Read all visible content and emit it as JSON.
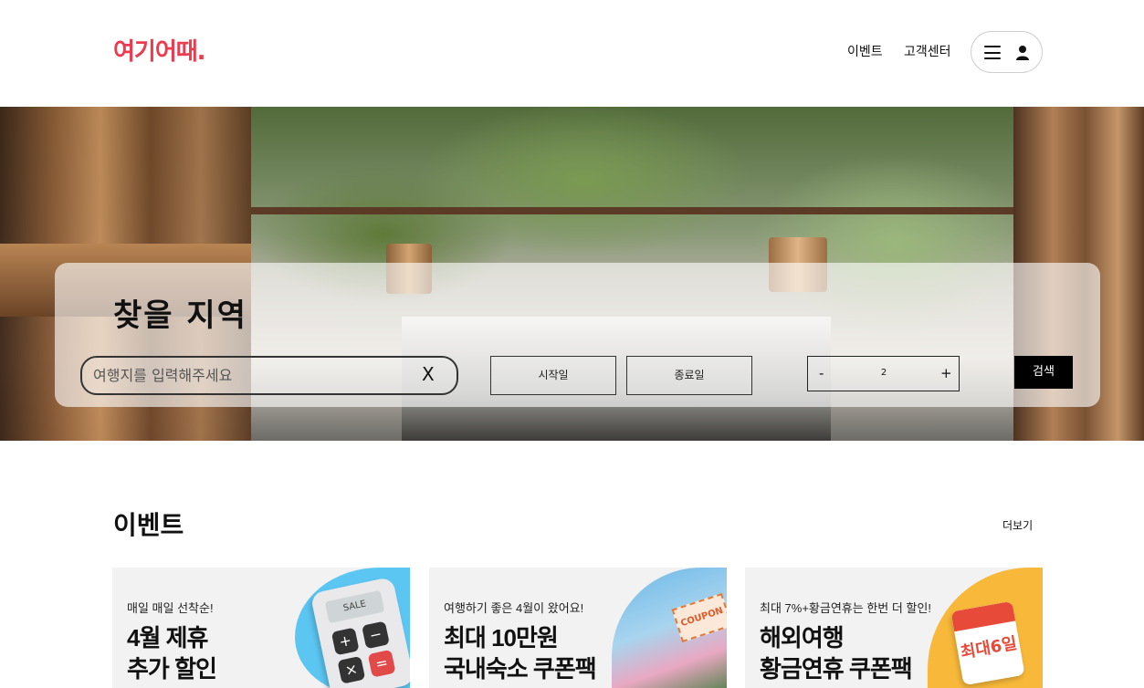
{
  "header": {
    "logo": "여기어때.",
    "nav": {
      "events": "이벤트",
      "support": "고객센터"
    },
    "icons": {
      "menu": "hamburger-menu-icon",
      "user": "user-icon"
    }
  },
  "search": {
    "title": "찾을 지역",
    "destination_placeholder": "여행지를 입력해주세요",
    "clear_label": "X",
    "start_date_label": "시작일",
    "end_date_label": "종료일",
    "guests": {
      "minus": "-",
      "count": "2",
      "plus": "+"
    },
    "search_button": "검색"
  },
  "events": {
    "title": "이벤트",
    "more": "더보기",
    "cards": [
      {
        "subtitle": "매일 매일 선착순!",
        "title_line1": "4월 제휴",
        "title_line2": "추가 할인",
        "art_text": "SALE"
      },
      {
        "subtitle": "여행하기 좋은 4월이 왔어요!",
        "title_line1": "최대 10만원",
        "title_line2": "국내숙소 쿠폰팩",
        "art_text": "COUPON"
      },
      {
        "subtitle": "최대 7%+황금연휴는 한번 더 할인!",
        "title_line1": "해외여행",
        "title_line2": "황금연휴 쿠폰팩",
        "art_text": "최대6일"
      }
    ]
  },
  "colors": {
    "brand": "#ec3b4f",
    "search_button": "#000000",
    "card_bg": "#f2f2f2"
  }
}
